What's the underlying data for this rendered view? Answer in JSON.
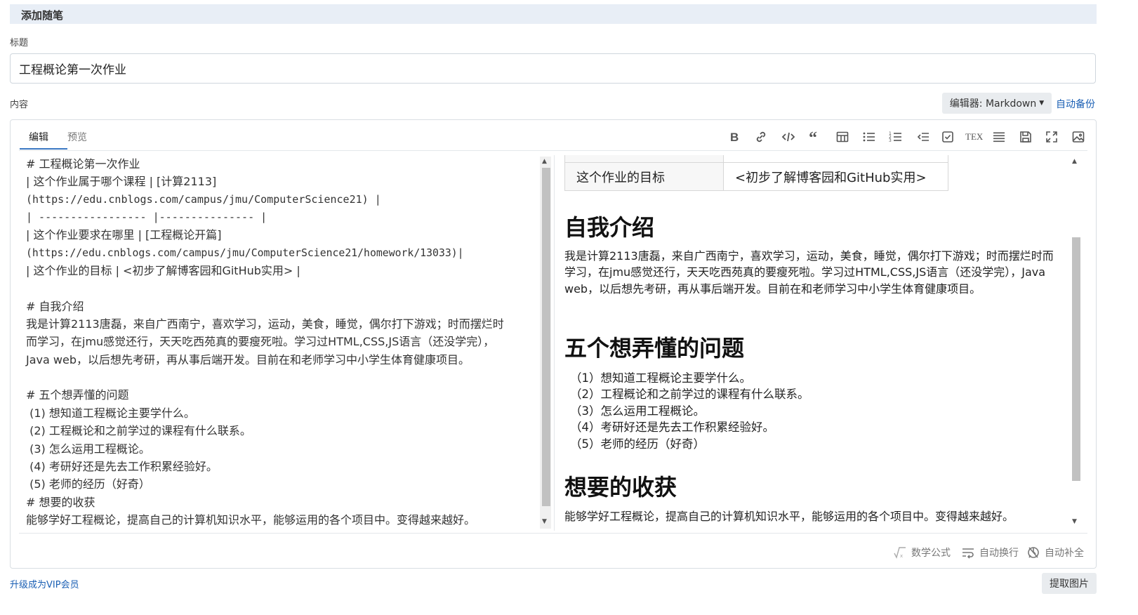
{
  "header": {
    "title": "添加随笔"
  },
  "form": {
    "title_label": "标题",
    "title_value": "工程概论第一次作业",
    "content_label": "内容",
    "editor_mode": "编辑器: Markdown",
    "auto_backup": "自动备份"
  },
  "tabs": {
    "edit": "编辑",
    "preview": "预览"
  },
  "toolbar": [
    {
      "name": "bold-icon"
    },
    {
      "name": "link-icon"
    },
    {
      "name": "code-icon"
    },
    {
      "name": "quote-icon"
    },
    {
      "name": "table-icon"
    },
    {
      "name": "unordered-list-icon"
    },
    {
      "name": "ordered-list-icon"
    },
    {
      "name": "indent-icon"
    },
    {
      "name": "checkbox-icon"
    },
    {
      "name": "tex-icon"
    },
    {
      "name": "horizontal-rule-icon"
    },
    {
      "name": "save-icon"
    },
    {
      "name": "fullscreen-icon"
    },
    {
      "name": "image-icon"
    }
  ],
  "source_lines": [
    {
      "text": "# 工程概论第一次作业",
      "cn": true
    },
    {
      "text": "| 这个作业属于哪个课程 | [计算2113]",
      "cn": true
    },
    {
      "text": "(https://edu.cnblogs.com/campus/jmu/ComputerScience21) |",
      "cn": false
    },
    {
      "text": "| ----------------- |--------------- |",
      "cn": false
    },
    {
      "text": "| 这个作业要求在哪里 | [工程概论开篇]",
      "cn": true
    },
    {
      "text": "(https://edu.cnblogs.com/campus/jmu/ComputerScience21/homework/13033)|",
      "cn": false
    },
    {
      "text": "| 这个作业的目标 | <初步了解博客园和GitHub实用> |",
      "cn": true
    },
    {
      "text": "",
      "cn": false
    },
    {
      "text": "# 自我介绍",
      "cn": true
    },
    {
      "text": "我是计算2113唐磊，来自广西南宁，喜欢学习，运动，美食，睡觉，偶尔打下游戏；时而摆烂时",
      "cn": true
    },
    {
      "text": "而学习，在jmu感觉还行，天天吃西苑真的要瘦死啦。学习过HTML,CSS,JS语言（还没学完），",
      "cn": true
    },
    {
      "text": "Java web，以后想先考研，再从事后端开发。目前在和老师学习中小学生体育健康项目。",
      "cn": true
    },
    {
      "text": "",
      "cn": false
    },
    {
      "text": "# 五个想弄懂的问题",
      "cn": true
    },
    {
      "text": " (1) 想知道工程概论主要学什么。",
      "cn": true
    },
    {
      "text": " (2) 工程概论和之前学过的课程有什么联系。",
      "cn": true
    },
    {
      "text": " (3) 怎么运用工程概论。",
      "cn": true
    },
    {
      "text": " (4) 考研好还是先去工作积累经验好。",
      "cn": true
    },
    {
      "text": " (5) 老师的经历（好奇）",
      "cn": true
    },
    {
      "text": "# 想要的收获",
      "cn": true
    },
    {
      "text": "能够学好工程概论，提高自己的计算机知识水平，能够运用的各个项目中。变得越来越好。",
      "cn": true
    }
  ],
  "preview": {
    "table_row": {
      "label": "这个作业的目标",
      "value": "<初步了解博客园和GitHub实用>"
    },
    "intro_heading": "自我介绍",
    "intro_text": "我是计算2113唐磊，来自广西南宁，喜欢学习，运动，美食，睡觉，偶尔打下游戏；时而摆烂时而学习，在jmu感觉还行，天天吃西苑真的要瘦死啦。学习过HTML,CSS,JS语言（还没学完），Java web，以后想先考研，再从事后端开发。目前在和老师学习中小学生体育健康项目。",
    "questions_heading": "五个想弄懂的问题",
    "questions": [
      "（1）想知道工程概论主要学什么。",
      "（2）工程概论和之前学过的课程有什么联系。",
      "（3）怎么运用工程概论。",
      "（4）考研好还是先去工作积累经验好。",
      "（5）老师的经历（好奇）"
    ],
    "gain_heading": "想要的收获",
    "gain_text": "能够学好工程概论，提高自己的计算机知识水平，能够运用的各个项目中。变得越来越好。"
  },
  "status": {
    "math": "数学公式",
    "wrap": "自动换行",
    "complete": "自动补全"
  },
  "footer": {
    "vip": "升级成为VIP会员",
    "extract": "提取图片"
  }
}
